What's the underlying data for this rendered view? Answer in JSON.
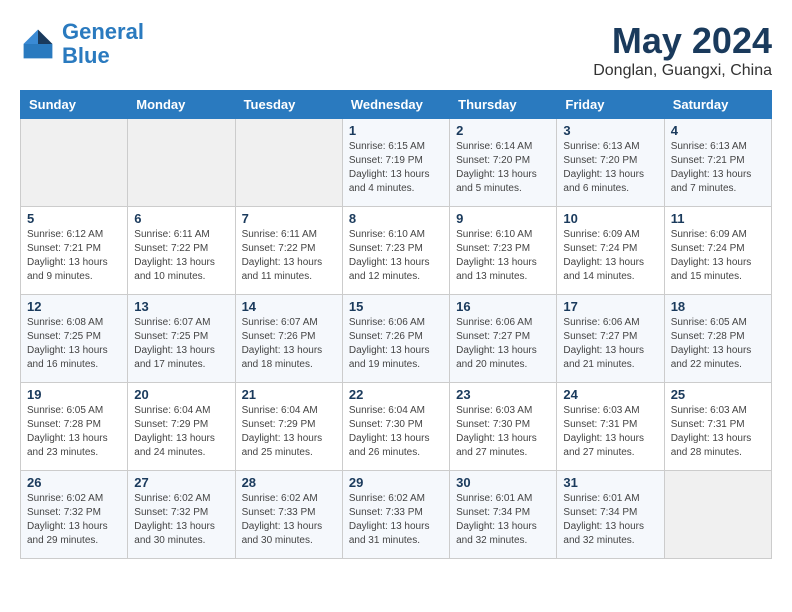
{
  "logo": {
    "line1": "General",
    "line2": "Blue"
  },
  "title": "May 2024",
  "location": "Donglan, Guangxi, China",
  "headers": [
    "Sunday",
    "Monday",
    "Tuesday",
    "Wednesday",
    "Thursday",
    "Friday",
    "Saturday"
  ],
  "weeks": [
    [
      {
        "day": "",
        "info": ""
      },
      {
        "day": "",
        "info": ""
      },
      {
        "day": "",
        "info": ""
      },
      {
        "day": "1",
        "info": "Sunrise: 6:15 AM\nSunset: 7:19 PM\nDaylight: 13 hours\nand 4 minutes."
      },
      {
        "day": "2",
        "info": "Sunrise: 6:14 AM\nSunset: 7:20 PM\nDaylight: 13 hours\nand 5 minutes."
      },
      {
        "day": "3",
        "info": "Sunrise: 6:13 AM\nSunset: 7:20 PM\nDaylight: 13 hours\nand 6 minutes."
      },
      {
        "day": "4",
        "info": "Sunrise: 6:13 AM\nSunset: 7:21 PM\nDaylight: 13 hours\nand 7 minutes."
      }
    ],
    [
      {
        "day": "5",
        "info": "Sunrise: 6:12 AM\nSunset: 7:21 PM\nDaylight: 13 hours\nand 9 minutes."
      },
      {
        "day": "6",
        "info": "Sunrise: 6:11 AM\nSunset: 7:22 PM\nDaylight: 13 hours\nand 10 minutes."
      },
      {
        "day": "7",
        "info": "Sunrise: 6:11 AM\nSunset: 7:22 PM\nDaylight: 13 hours\nand 11 minutes."
      },
      {
        "day": "8",
        "info": "Sunrise: 6:10 AM\nSunset: 7:23 PM\nDaylight: 13 hours\nand 12 minutes."
      },
      {
        "day": "9",
        "info": "Sunrise: 6:10 AM\nSunset: 7:23 PM\nDaylight: 13 hours\nand 13 minutes."
      },
      {
        "day": "10",
        "info": "Sunrise: 6:09 AM\nSunset: 7:24 PM\nDaylight: 13 hours\nand 14 minutes."
      },
      {
        "day": "11",
        "info": "Sunrise: 6:09 AM\nSunset: 7:24 PM\nDaylight: 13 hours\nand 15 minutes."
      }
    ],
    [
      {
        "day": "12",
        "info": "Sunrise: 6:08 AM\nSunset: 7:25 PM\nDaylight: 13 hours\nand 16 minutes."
      },
      {
        "day": "13",
        "info": "Sunrise: 6:07 AM\nSunset: 7:25 PM\nDaylight: 13 hours\nand 17 minutes."
      },
      {
        "day": "14",
        "info": "Sunrise: 6:07 AM\nSunset: 7:26 PM\nDaylight: 13 hours\nand 18 minutes."
      },
      {
        "day": "15",
        "info": "Sunrise: 6:06 AM\nSunset: 7:26 PM\nDaylight: 13 hours\nand 19 minutes."
      },
      {
        "day": "16",
        "info": "Sunrise: 6:06 AM\nSunset: 7:27 PM\nDaylight: 13 hours\nand 20 minutes."
      },
      {
        "day": "17",
        "info": "Sunrise: 6:06 AM\nSunset: 7:27 PM\nDaylight: 13 hours\nand 21 minutes."
      },
      {
        "day": "18",
        "info": "Sunrise: 6:05 AM\nSunset: 7:28 PM\nDaylight: 13 hours\nand 22 minutes."
      }
    ],
    [
      {
        "day": "19",
        "info": "Sunrise: 6:05 AM\nSunset: 7:28 PM\nDaylight: 13 hours\nand 23 minutes."
      },
      {
        "day": "20",
        "info": "Sunrise: 6:04 AM\nSunset: 7:29 PM\nDaylight: 13 hours\nand 24 minutes."
      },
      {
        "day": "21",
        "info": "Sunrise: 6:04 AM\nSunset: 7:29 PM\nDaylight: 13 hours\nand 25 minutes."
      },
      {
        "day": "22",
        "info": "Sunrise: 6:04 AM\nSunset: 7:30 PM\nDaylight: 13 hours\nand 26 minutes."
      },
      {
        "day": "23",
        "info": "Sunrise: 6:03 AM\nSunset: 7:30 PM\nDaylight: 13 hours\nand 27 minutes."
      },
      {
        "day": "24",
        "info": "Sunrise: 6:03 AM\nSunset: 7:31 PM\nDaylight: 13 hours\nand 27 minutes."
      },
      {
        "day": "25",
        "info": "Sunrise: 6:03 AM\nSunset: 7:31 PM\nDaylight: 13 hours\nand 28 minutes."
      }
    ],
    [
      {
        "day": "26",
        "info": "Sunrise: 6:02 AM\nSunset: 7:32 PM\nDaylight: 13 hours\nand 29 minutes."
      },
      {
        "day": "27",
        "info": "Sunrise: 6:02 AM\nSunset: 7:32 PM\nDaylight: 13 hours\nand 30 minutes."
      },
      {
        "day": "28",
        "info": "Sunrise: 6:02 AM\nSunset: 7:33 PM\nDaylight: 13 hours\nand 30 minutes."
      },
      {
        "day": "29",
        "info": "Sunrise: 6:02 AM\nSunset: 7:33 PM\nDaylight: 13 hours\nand 31 minutes."
      },
      {
        "day": "30",
        "info": "Sunrise: 6:01 AM\nSunset: 7:34 PM\nDaylight: 13 hours\nand 32 minutes."
      },
      {
        "day": "31",
        "info": "Sunrise: 6:01 AM\nSunset: 7:34 PM\nDaylight: 13 hours\nand 32 minutes."
      },
      {
        "day": "",
        "info": ""
      }
    ]
  ]
}
